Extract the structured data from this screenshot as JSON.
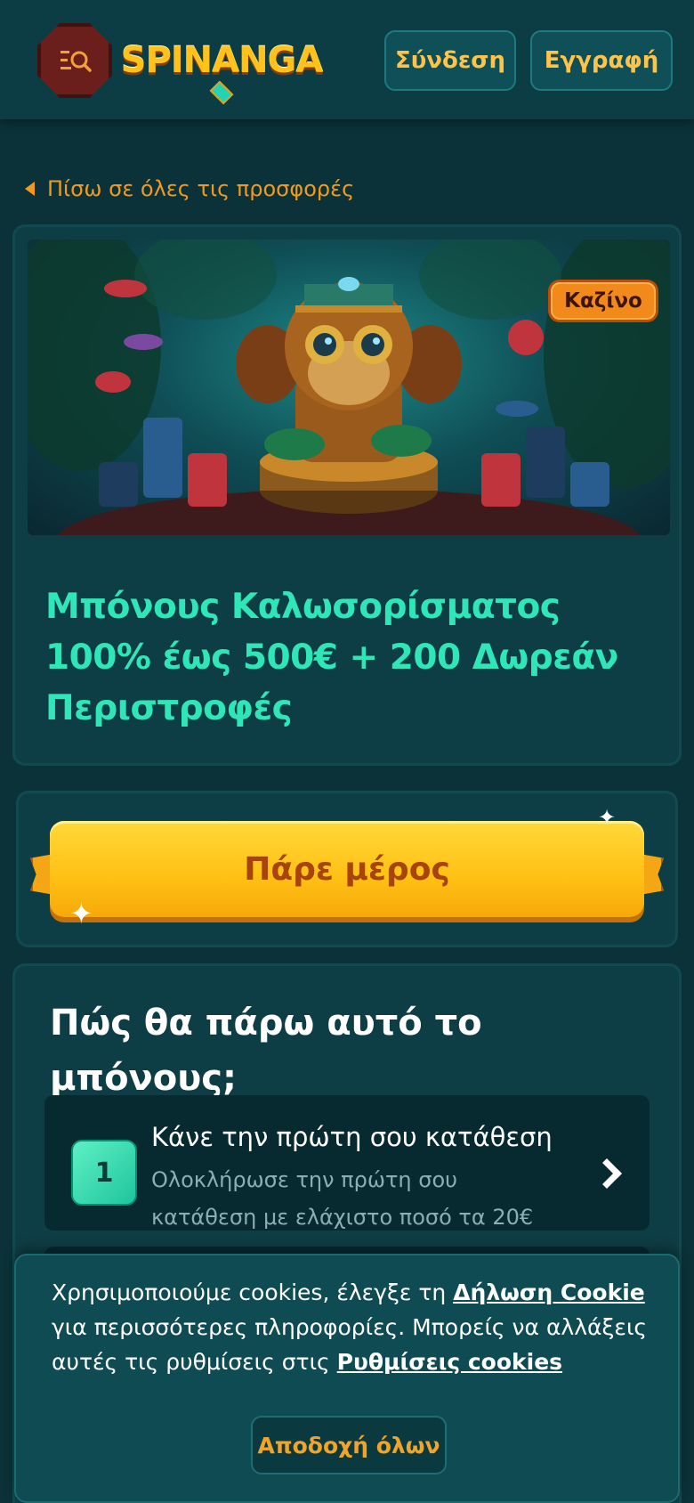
{
  "header": {
    "logo_text": "SPINANGA",
    "login_label": "Σύνδεση",
    "register_label": "Εγγραφή"
  },
  "back_link": {
    "label": "Πίσω σε όλες τις προσφορές"
  },
  "promo": {
    "badge": "Καζίνο",
    "title": "Μπόνους Καλωσορίσματος 100% έως 500€ + 200 Δωρεάν Περιστροφές"
  },
  "cta": {
    "label": "Πάρε μέρος"
  },
  "how": {
    "title": "Πώς θα πάρω αυτό το μπόνους;",
    "steps": [
      {
        "number": "1",
        "heading": "Κάνε την πρώτη σου κατάθεση",
        "description": "Ολοκλήρωσε την πρώτη σου κατάθεση με ελάχιστο ποσό τα 20€"
      }
    ]
  },
  "cookie": {
    "text_before": "Χρησιμοποιούμε cookies, έλεγξε τη ",
    "link_statement": "Δήλωση Cookie",
    "text_middle": " για περισσότερες πληροφορίες. Μπορείς να αλλάξεις αυτές τις ρυθμίσεις στις ",
    "link_settings": "Ρυθμίσεις cookies",
    "accept_label": "Αποδοχή όλων"
  },
  "colors": {
    "accent_title": "#2ee6b8",
    "accent_orange": "#f39a1e",
    "cta_yellow": "#ffc013",
    "background": "#0b3238"
  },
  "icons": {
    "menu": "search-list-icon",
    "back": "chevron-left-icon",
    "step_arrow": "chevron-right-icon"
  }
}
